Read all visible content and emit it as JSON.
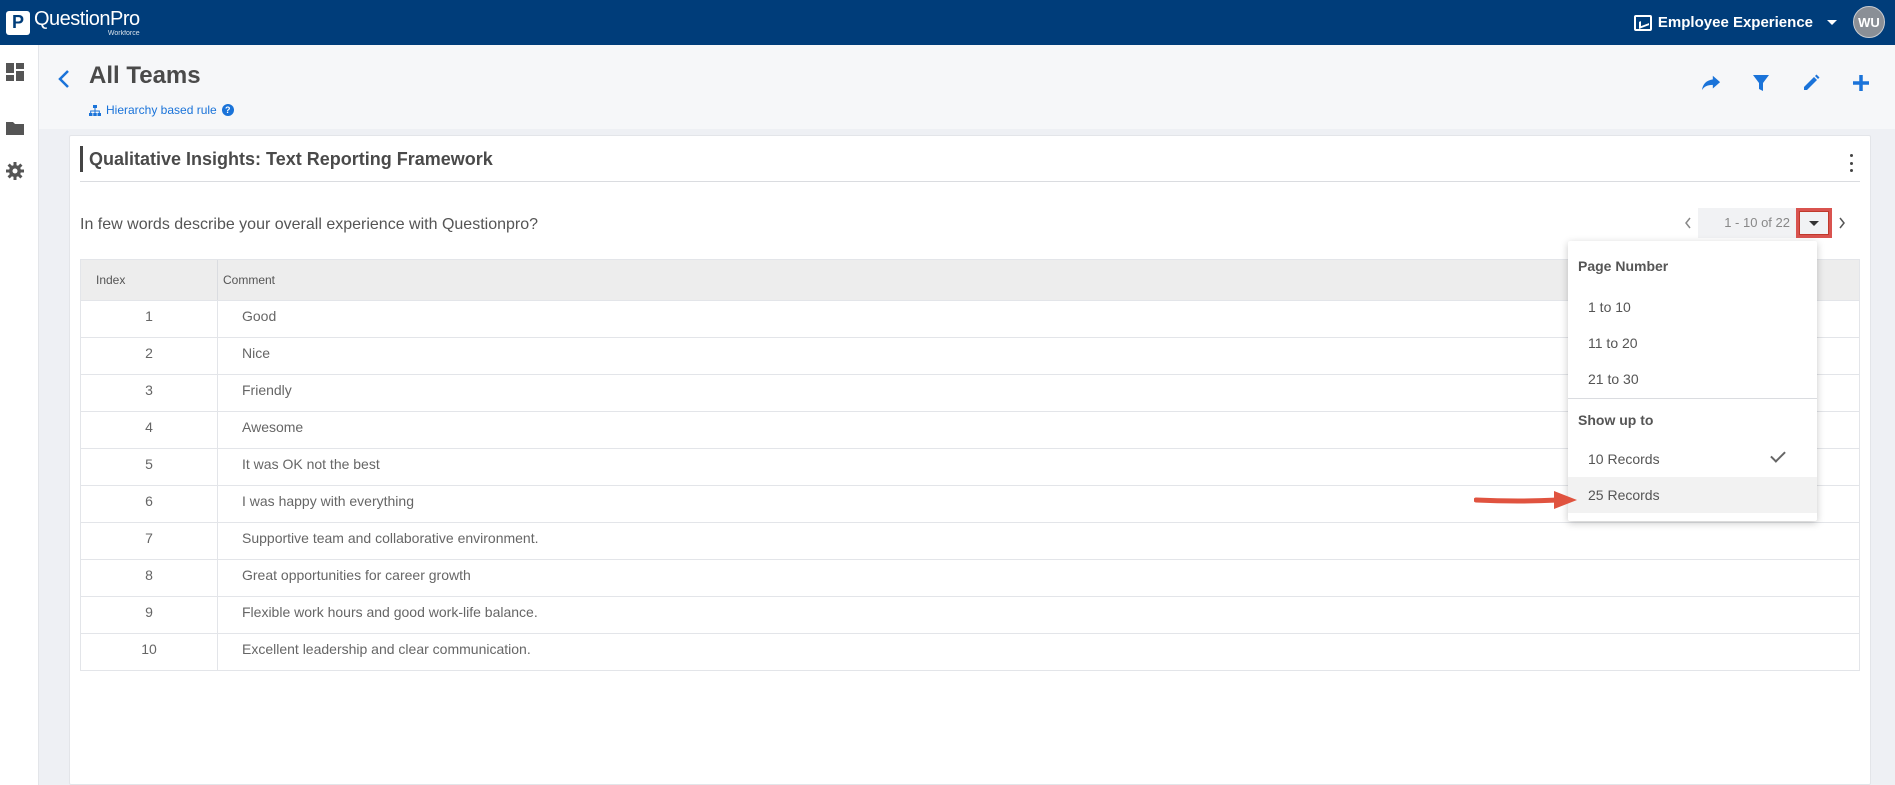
{
  "topbar": {
    "logo_letter": "P",
    "logo_name": "QuestionPro",
    "logo_sub": "Workforce",
    "product_name": "Employee Experience",
    "avatar_initials": "WU",
    "bg_color": "#003d7a"
  },
  "sidebar": {
    "items": [
      {
        "icon": "dashboard-icon"
      },
      {
        "icon": "folder-icon"
      },
      {
        "icon": "gear-icon"
      }
    ]
  },
  "header": {
    "back_icon": "chevron-left-icon",
    "title": "All Teams",
    "rule_label": "Hierarchy based rule",
    "rule_help": "?",
    "tools": [
      "share-icon",
      "filter-icon",
      "edit-icon",
      "plus-icon"
    ],
    "accent": "#1a73d9"
  },
  "card": {
    "title": "Qualitative Insights: Text Reporting Framework",
    "question": "In few words describe your overall experience with Questionpro?",
    "pager": {
      "range": "1 - 10 of 22"
    },
    "table": {
      "columns": [
        "Index",
        "Comment"
      ],
      "rows": [
        {
          "index": "1",
          "comment": "Good"
        },
        {
          "index": "2",
          "comment": "Nice"
        },
        {
          "index": "3",
          "comment": "Friendly"
        },
        {
          "index": "4",
          "comment": "Awesome"
        },
        {
          "index": "5",
          "comment": "It was OK not the best"
        },
        {
          "index": "6",
          "comment": "I was happy with everything"
        },
        {
          "index": "7",
          "comment": "Supportive team and collaborative environment."
        },
        {
          "index": "8",
          "comment": "Great opportunities for career growth"
        },
        {
          "index": "9",
          "comment": "Flexible work hours and good work-life balance."
        },
        {
          "index": "10",
          "comment": "Excellent leadership and clear communication."
        }
      ]
    }
  },
  "dropdown": {
    "page_number_heading": "Page Number",
    "page_options": [
      "1 to 10",
      "11 to 20",
      "21 to 30"
    ],
    "show_heading": "Show up to",
    "record_options": [
      {
        "label": "10 Records",
        "selected": true
      },
      {
        "label": "25 Records",
        "selected": false
      }
    ],
    "highlight_color": "#d9534f"
  }
}
